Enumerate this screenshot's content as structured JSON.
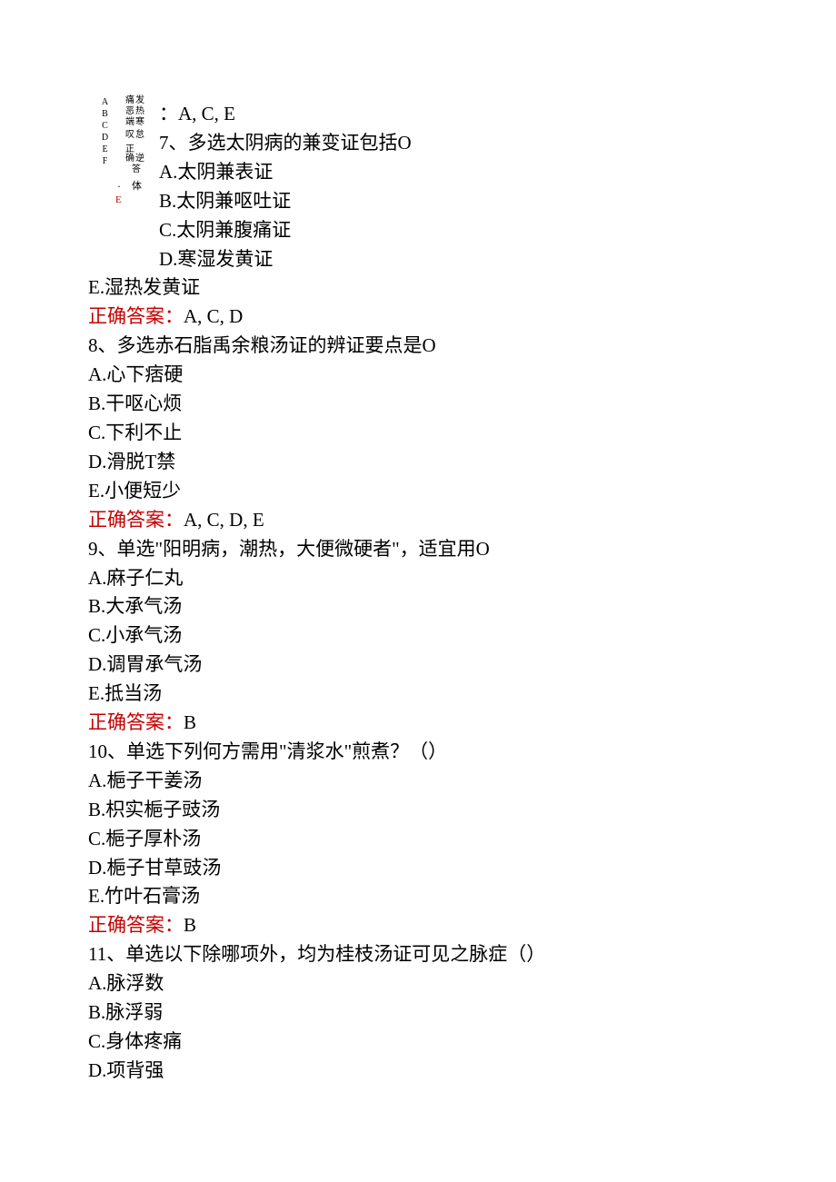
{
  "vertical": {
    "head_a": "痛发",
    "head_b": "恶热",
    "head_c": "端",
    "head_d": "寒",
    "head_e": "叹怠",
    "head_f": "正",
    "head_g": "确逆",
    "head_h": "答",
    "abc": "ABCDEF",
    "dot": "·",
    "red_e": "E",
    "ti": "体"
  },
  "q6": {
    "answer": "：A, C, E"
  },
  "q7": {
    "prompt": "7、多选太阴病的兼变证包括O",
    "a": "A.太阴兼表证",
    "b": "B.太阴兼呕吐证",
    "c": "C.太阴兼腹痛证",
    "d": "D.寒湿发黄证",
    "e": "E.湿热发黄证",
    "ans_label": "正确答案：",
    "ans_value": "A, C, D"
  },
  "q8": {
    "prompt": "8、多选赤石脂禹余粮汤证的辨证要点是O",
    "a": "A.心下痞硬",
    "b": "B.干呕心烦",
    "c": "C.下利不止",
    "d": "D.滑脱T禁",
    "e": "E.小便短少",
    "ans_label": "正确答案：",
    "ans_value": "A, C, D, E"
  },
  "q9": {
    "prompt": "9、单选\"阳明病，潮热，大便微硬者\"，适宜用O",
    "a": "A.麻子仁丸",
    "b": "B.大承气汤",
    "c": "C.小承气汤",
    "d": "D.调胃承气汤",
    "e": "E.抵当汤",
    "ans_label": "正确答案：",
    "ans_value": "B"
  },
  "q10": {
    "prompt": "10、单选下列何方需用\"清浆水\"煎煮？（）",
    "a": "A.梔子干姜汤",
    "b": "B.枳实梔子豉汤",
    "c": "C.梔子厚朴汤",
    "d": "D.梔子甘草豉汤",
    "e": "E.竹叶石膏汤",
    "ans_label": "正确答案：",
    "ans_value": "B"
  },
  "q11": {
    "prompt": "11、单选以下除哪项外，均为桂枝汤证可见之脉症（）",
    "a": "A.脉浮数",
    "b": "B.脉浮弱",
    "c": "C.身体疼痛",
    "d": "D.项背强"
  }
}
